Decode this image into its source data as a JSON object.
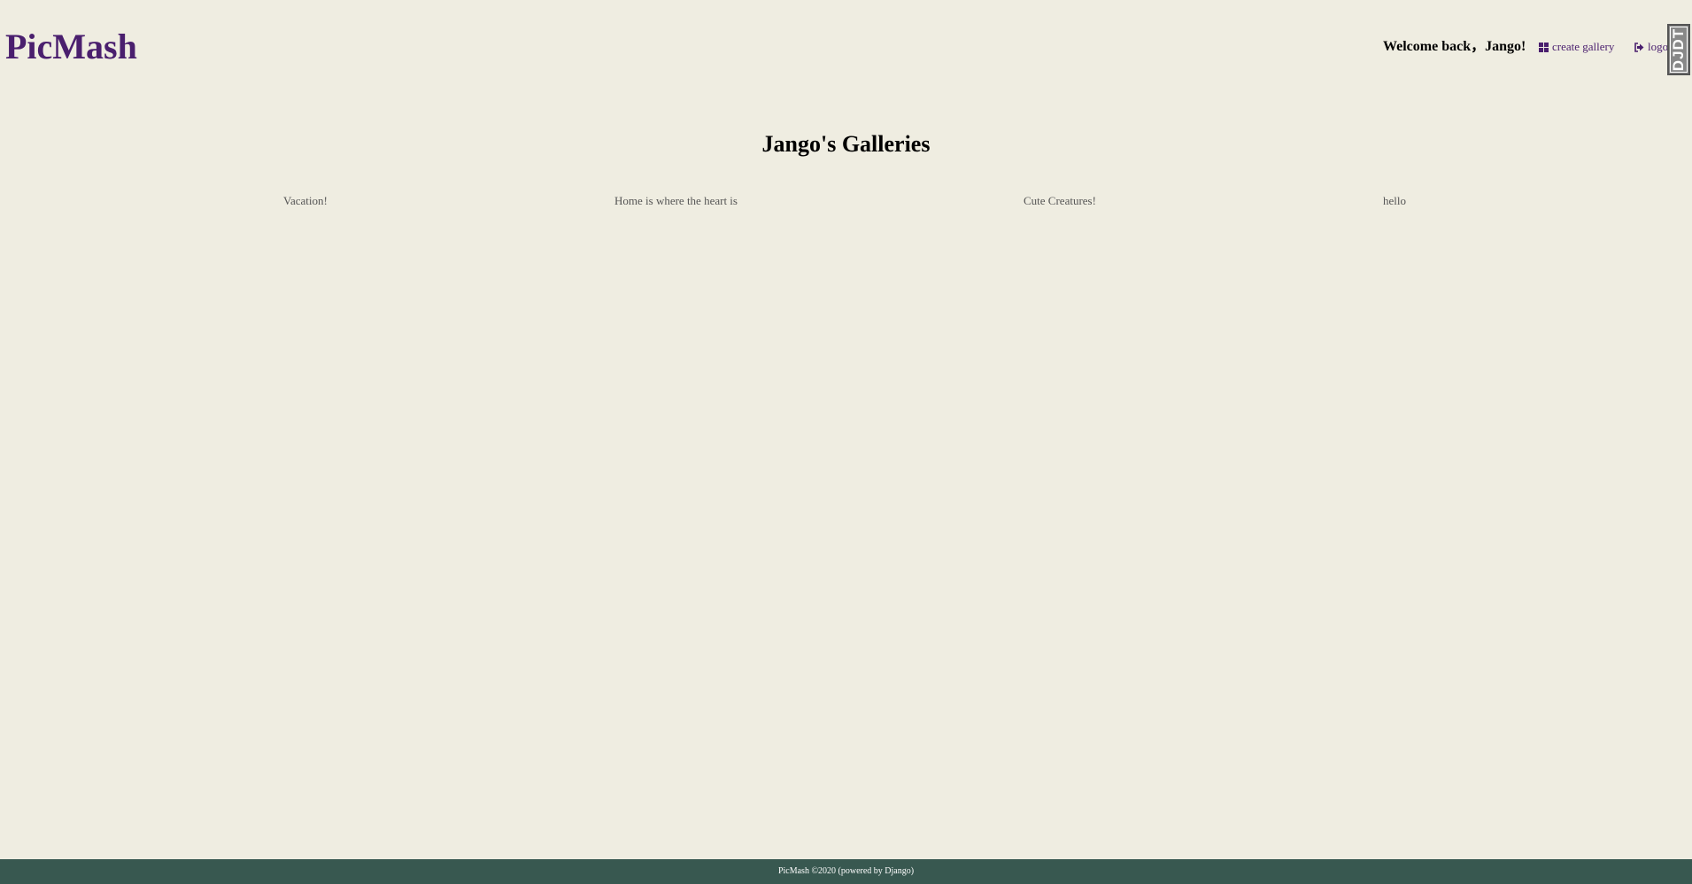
{
  "header": {
    "logo": "PicMash",
    "welcome": "Welcome back，Jango!",
    "create_gallery": {
      "icon": "grid-icon",
      "label": "create gallery"
    },
    "logout": {
      "icon": "logout-icon",
      "label": "logou"
    }
  },
  "debug_toolbar": {
    "label": "DJDT"
  },
  "main": {
    "title": "Jango's Galleries",
    "galleries": [
      "Vacation!",
      "Home is where the heart is",
      "Cute Creatures!",
      "hello"
    ]
  },
  "footer": {
    "text": "PicMash ©2020 (powered by Django)"
  },
  "colors": {
    "background": "#efede1",
    "brand": "#4a1f6e",
    "footer": "#385850",
    "gallery_text": "#555555"
  }
}
